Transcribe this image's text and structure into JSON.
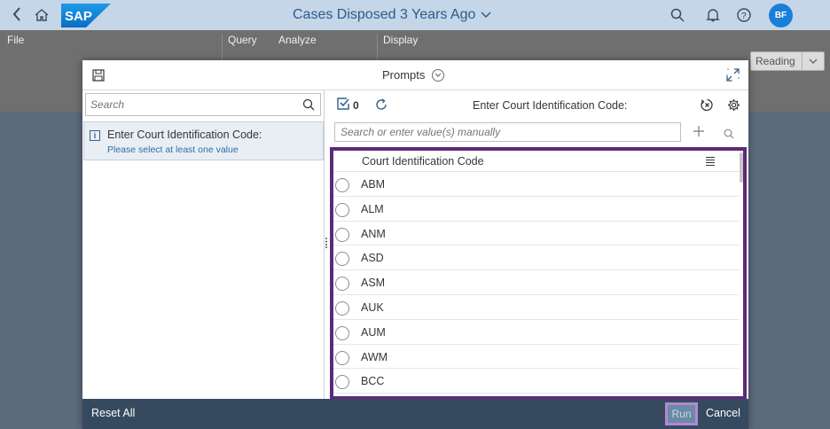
{
  "shell": {
    "title": "Cases Disposed 3 Years Ago",
    "avatar_initials": "BF",
    "logo_text": "SAP"
  },
  "toolbar": {
    "file_label": "File",
    "query_label": "Query",
    "analyze_label": "Analyze",
    "display_label": "Display",
    "view_mode": "Reading"
  },
  "dialog": {
    "title": "Prompts",
    "left": {
      "search_placeholder": "Search",
      "prompt_name": "Enter Court Identification Code:",
      "prompt_hint": "Please select at least one value"
    },
    "right": {
      "selected_count": "0",
      "title": "Enter Court Identification Code:",
      "value_placeholder": "Search or enter value(s) manually",
      "column_header": "Court Identification Code",
      "values": [
        "ABM",
        "ALM",
        "ANM",
        "ASD",
        "ASM",
        "AUK",
        "AUM",
        "AWM",
        "BCC"
      ]
    },
    "footer": {
      "reset_label": "Reset All",
      "run_label": "Run",
      "cancel_label": "Cancel"
    }
  },
  "colors": {
    "shell_bg": "#c5d6e8",
    "footer_bg": "#354a5f",
    "list_highlight_border": "#5d2a7a",
    "run_highlight_border": "#b486d6",
    "avatar_bg": "#1a7fd6"
  }
}
